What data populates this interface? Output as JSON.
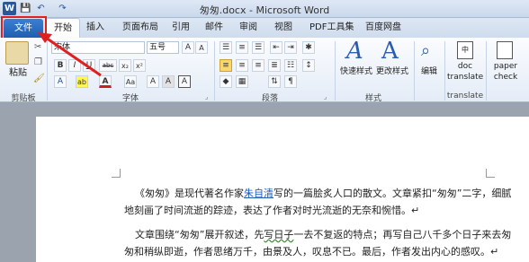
{
  "window": {
    "title": "匆匆.docx - Microsoft Word"
  },
  "quick_access": {
    "word_icon": "W",
    "save_icon": "💾",
    "undo_icon": "↶",
    "redo_icon": "↷"
  },
  "tabs": {
    "file": "文件",
    "items": [
      "开始",
      "插入",
      "页面布局",
      "引用",
      "邮件",
      "审阅",
      "视图",
      "PDF工具集",
      "百度网盘"
    ]
  },
  "ribbon": {
    "clipboard": {
      "paste": "粘贴",
      "label": "剪贴板"
    },
    "font": {
      "name": "宋体",
      "size": "五号",
      "label": "字体",
      "row1": [
        "A",
        "A",
        "Aa",
        "A"
      ],
      "row2": [
        "B",
        "I",
        "U",
        "abc",
        "x₂",
        "x²"
      ],
      "row3": [
        "A",
        "ab",
        "A",
        "Aa",
        "A",
        "A",
        "A"
      ]
    },
    "paragraph": {
      "label": "段落"
    },
    "styles": {
      "quick": "快速样式",
      "change": "更改样式",
      "label": "样式"
    },
    "editing": {
      "label": "编辑"
    },
    "translate": {
      "btn": "doc translate",
      "label": "translate"
    },
    "paper": {
      "btn": "paper check"
    }
  },
  "document": {
    "para1": {
      "p1": "《匆匆》是现代著名作家",
      "author": "朱自清",
      "p2": "写的一篇脍炙人口的散文。文章紧扣“匆匆”二字，细腻",
      "line2": "地刻画了时间流逝的踪迹，表达了作者对时光流逝的无奈和惋惜。↵"
    },
    "para2": {
      "p1": "文章围绕“匆匆”展开叙述，先",
      "w1": "写日子",
      "p2": "一去不复返的特点；再写自己八千多个日子来去匆",
      "line2": "匆和稍纵即逝，作者思绪万千，由景及人，叹息不已。最后，作者发出内心的感叹。↵"
    }
  },
  "colors": {
    "file_tab": "#2a6cc4",
    "highlight_box": "#e02020"
  }
}
